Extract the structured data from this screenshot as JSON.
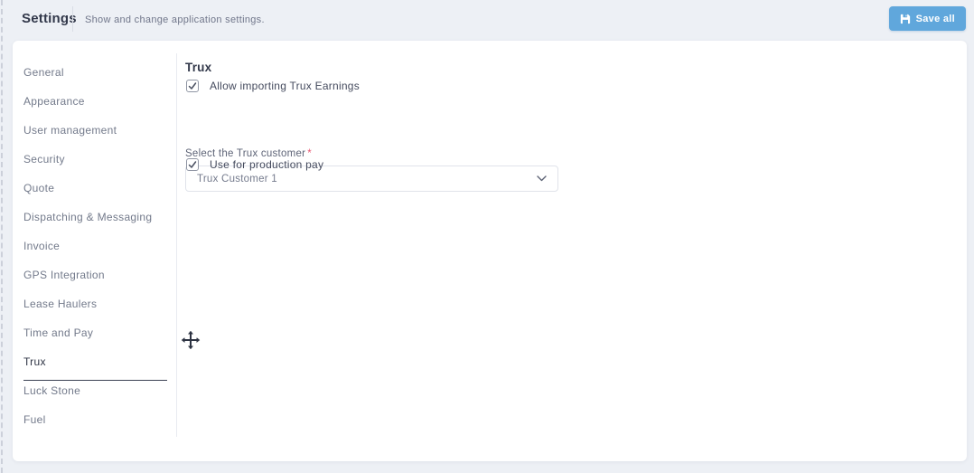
{
  "header": {
    "title": "Settings",
    "subtitle": "Show and change application settings.",
    "save_button": "Save all"
  },
  "sidebar": {
    "items": [
      {
        "label": "General",
        "active": false
      },
      {
        "label": "Appearance",
        "active": false
      },
      {
        "label": "User management",
        "active": false
      },
      {
        "label": "Security",
        "active": false
      },
      {
        "label": "Quote",
        "active": false
      },
      {
        "label": "Dispatching & Messaging",
        "active": false
      },
      {
        "label": "Invoice",
        "active": false
      },
      {
        "label": "GPS Integration",
        "active": false
      },
      {
        "label": "Lease Haulers",
        "active": false
      },
      {
        "label": "Time and Pay",
        "active": false
      },
      {
        "label": "Trux",
        "active": true
      },
      {
        "label": "Luck Stone",
        "active": false
      },
      {
        "label": "Fuel",
        "active": false
      }
    ]
  },
  "content": {
    "section_title": "Trux",
    "checkbox_import": {
      "label": "Allow importing Trux Earnings",
      "checked": true
    },
    "customer_select": {
      "label": "Select the Trux customer",
      "required_mark": "*",
      "value": "Trux Customer 1"
    },
    "checkbox_production": {
      "label": "Use for production pay",
      "checked": true
    }
  },
  "colors": {
    "accent_blue": "#60a7dc",
    "page_background": "#edf0f5",
    "active_text": "#2f3545",
    "required_red": "#e85672"
  }
}
